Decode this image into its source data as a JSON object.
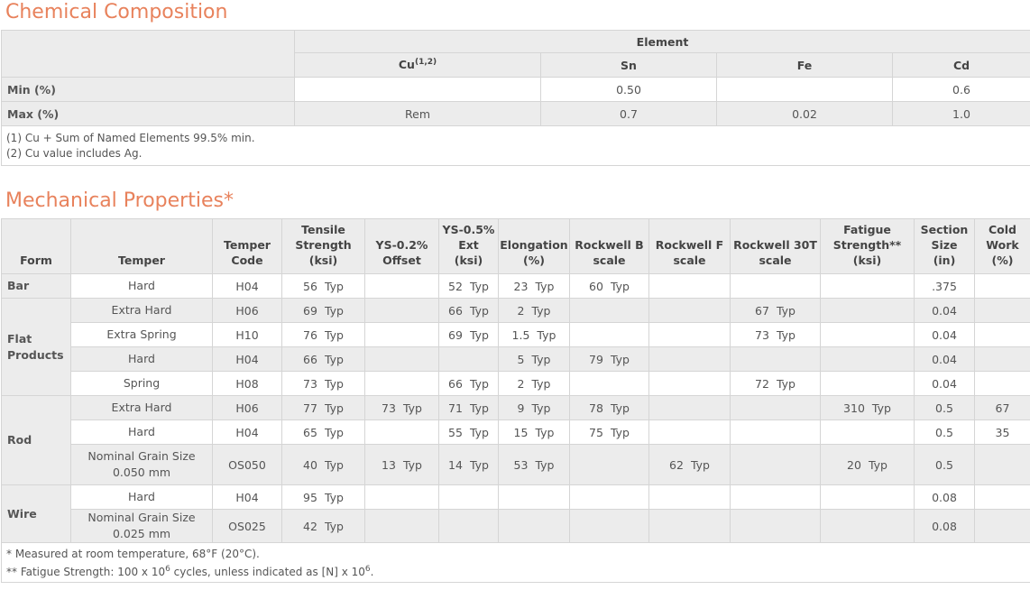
{
  "chem": {
    "title": "Chemical Composition",
    "element_header": "Element",
    "elements": [
      "Cu",
      "Sn",
      "Fe",
      "Cd"
    ],
    "cu_sup": "(1,2)",
    "rows": [
      {
        "label": "Min (%)",
        "values": [
          "",
          "0.50",
          "",
          "0.6"
        ]
      },
      {
        "label": "Max (%)",
        "values": [
          "Rem",
          "0.7",
          "0.02",
          "1.0"
        ]
      }
    ],
    "notes": [
      "(1) Cu + Sum of Named Elements 99.5% min.",
      "(2) Cu value includes Ag."
    ]
  },
  "mech": {
    "title": "Mechanical Properties*",
    "headers": {
      "form": "Form",
      "temper": "Temper",
      "code": [
        "Temper",
        "Code"
      ],
      "ts": [
        "Tensile",
        "Strength",
        "(ksi)"
      ],
      "ys2": [
        "YS-0.2%",
        "Offset"
      ],
      "ys5": [
        "YS-0.5%",
        "Ext",
        "(ksi)"
      ],
      "el": [
        "Elongation",
        "(%)"
      ],
      "rb": [
        "Rockwell B",
        "scale"
      ],
      "rf": [
        "Rockwell F",
        "scale"
      ],
      "r30": [
        "Rockwell 30T",
        "scale"
      ],
      "fs": [
        "Fatigue",
        "Strength**",
        "(ksi)"
      ],
      "ss": [
        "Section",
        "Size",
        "(in)"
      ],
      "cw": [
        "Cold",
        "Work",
        "(%)"
      ]
    },
    "typ": "Typ",
    "forms": [
      {
        "form": "Bar",
        "rows": [
          {
            "temper": "Hard",
            "code": "H04",
            "ts": "56",
            "ys2": "",
            "ys5": "52",
            "el": "23",
            "rb": "60",
            "rf": "",
            "r30": "",
            "fs": "",
            "ss": ".375",
            "cw": ""
          }
        ]
      },
      {
        "form": "Flat Products",
        "rows": [
          {
            "temper": "Extra Hard",
            "code": "H06",
            "ts": "69",
            "ys2": "",
            "ys5": "66",
            "el": "2",
            "rb": "",
            "rf": "",
            "r30": "67",
            "fs": "",
            "ss": "0.04",
            "cw": ""
          },
          {
            "temper": "Extra Spring",
            "code": "H10",
            "ts": "76",
            "ys2": "",
            "ys5": "69",
            "el": "1.5",
            "rb": "",
            "rf": "",
            "r30": "73",
            "fs": "",
            "ss": "0.04",
            "cw": ""
          },
          {
            "temper": "Hard",
            "code": "H04",
            "ts": "66",
            "ys2": "",
            "ys5": "",
            "el": "5",
            "rb": "79",
            "rf": "",
            "r30": "",
            "fs": "",
            "ss": "0.04",
            "cw": ""
          },
          {
            "temper": "Spring",
            "code": "H08",
            "ts": "73",
            "ys2": "",
            "ys5": "66",
            "el": "2",
            "rb": "",
            "rf": "",
            "r30": "72",
            "fs": "",
            "ss": "0.04",
            "cw": ""
          }
        ]
      },
      {
        "form": "Rod",
        "rows": [
          {
            "temper": "Extra Hard",
            "code": "H06",
            "ts": "77",
            "ys2": "73",
            "ys5": "71",
            "el": "9",
            "rb": "78",
            "rf": "",
            "r30": "",
            "fs": "310",
            "ss": "0.5",
            "cw": "67"
          },
          {
            "temper": "Hard",
            "code": "H04",
            "ts": "65",
            "ys2": "",
            "ys5": "55",
            "el": "15",
            "rb": "75",
            "rf": "",
            "r30": "",
            "fs": "",
            "ss": "0.5",
            "cw": "35"
          },
          {
            "temper": "Nominal Grain Size 0.050 mm",
            "code": "OS050",
            "ts": "40",
            "ys2": "13",
            "ys5": "14",
            "el": "53",
            "rb": "",
            "rf": "62",
            "r30": "",
            "fs": "20",
            "ss": "0.5",
            "cw": ""
          }
        ]
      },
      {
        "form": "Wire",
        "rows": [
          {
            "temper": "Hard",
            "code": "H04",
            "ts": "95",
            "ys2": "",
            "ys5": "",
            "el": "",
            "rb": "",
            "rf": "",
            "r30": "",
            "fs": "",
            "ss": "0.08",
            "cw": ""
          },
          {
            "temper": "Nominal Grain Size 0.025 mm",
            "code": "OS025",
            "ts": "42",
            "ys2": "",
            "ys5": "",
            "el": "",
            "rb": "",
            "rf": "",
            "r30": "",
            "fs": "",
            "ss": "0.08",
            "cw": ""
          }
        ]
      }
    ],
    "notes": [
      {
        "text": "* Measured at room temperature, 68°F (20°C).",
        "sup": "",
        "tail": ""
      },
      {
        "text": "** Fatigue Strength: 100 x 10",
        "sup": "6",
        "mid": " cycles, unless indicated as [N] x 10",
        "sup2": "6",
        "tail": "."
      }
    ]
  }
}
